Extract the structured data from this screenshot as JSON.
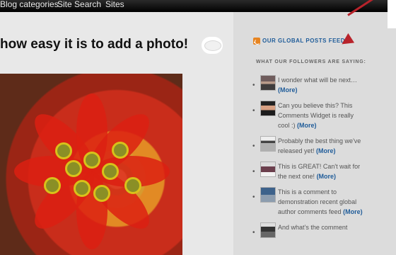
{
  "nav": {
    "items": [
      "Blog categories",
      "Site Search",
      "Sites"
    ]
  },
  "post": {
    "title": "how easy it is to add a photo!"
  },
  "sidebar": {
    "feed_link": "OUR GLOBAL POSTS FEED",
    "heading": "WHAT OUR FOLLOWERS ARE SAYING:",
    "comments": [
      {
        "text": "I wonder what will be next…",
        "more": "(More)"
      },
      {
        "text": "Can you believe this? This Comments Widget is really cool :)",
        "more": "(More)"
      },
      {
        "text": "Probably the best thing we've released yet!",
        "more": "(More)"
      },
      {
        "text": "This is GREAT! Can't wait for the next one!",
        "more": "(More)"
      },
      {
        "text": "This is a comment to demonstration recent global author comments feed",
        "more": "(More)"
      },
      {
        "text": "And what’s the comment",
        "more": ""
      }
    ]
  },
  "colors": {
    "link": "#1f5c99",
    "rss": "#e68421",
    "arrow": "#b8232b",
    "navbar": "#000000"
  },
  "icons": {
    "feed_icon": "rss-icon",
    "comment_icon": "comment-bubble-icon",
    "arrow_icon": "arrow-icon"
  }
}
